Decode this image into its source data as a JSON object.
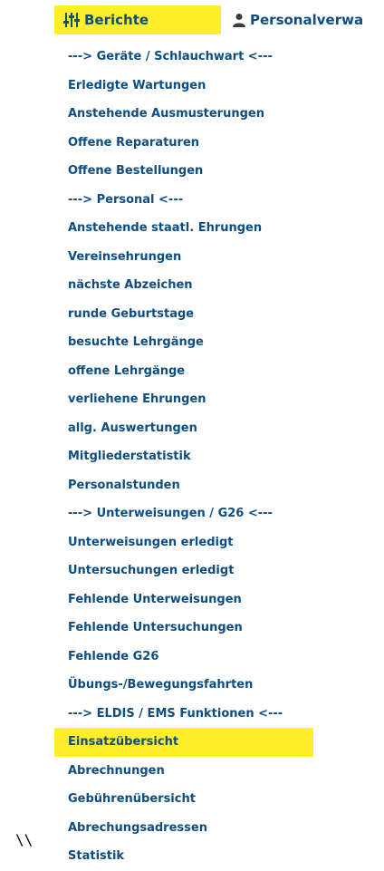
{
  "colors": {
    "highlight": "#ffef2a",
    "link": "#0d4d82"
  },
  "topnav": {
    "berichte": {
      "label": "Berichte",
      "icon": "sliders-icon",
      "active": true
    },
    "personal": {
      "label": "Personalverwa",
      "icon": "user-icon"
    }
  },
  "menu": {
    "items": [
      {
        "label": "---> Geräte / Schlauchwart <---",
        "type": "separator"
      },
      {
        "label": "Erledigte Wartungen"
      },
      {
        "label": "Anstehende Ausmusterungen"
      },
      {
        "label": "Offene Reparaturen"
      },
      {
        "label": "Offene Bestellungen"
      },
      {
        "label": "---> Personal <---",
        "type": "separator"
      },
      {
        "label": "Anstehende staatl. Ehrungen"
      },
      {
        "label": "Vereinsehrungen"
      },
      {
        "label": "nächste Abzeichen"
      },
      {
        "label": "runde Geburtstage"
      },
      {
        "label": "besuchte Lehrgänge"
      },
      {
        "label": "offene Lehrgänge"
      },
      {
        "label": "verliehene Ehrungen"
      },
      {
        "label": "allg. Auswertungen"
      },
      {
        "label": "Mitgliederstatistik"
      },
      {
        "label": "Personalstunden"
      },
      {
        "label": "---> Unterweisungen / G26 <---",
        "type": "separator"
      },
      {
        "label": "Unterweisungen erledigt"
      },
      {
        "label": "Untersuchungen erledigt"
      },
      {
        "label": "Fehlende Unterweisungen"
      },
      {
        "label": "Fehlende Untersuchungen"
      },
      {
        "label": "Fehlende G26"
      },
      {
        "label": "Übungs-/Bewegungsfahrten"
      },
      {
        "label": "---> ELDIS / EMS Funktionen <---",
        "type": "separator"
      },
      {
        "label": "Einsatzübersicht",
        "highlighted": true
      },
      {
        "label": "Abrechnungen"
      },
      {
        "label": "Gebührenübersicht"
      },
      {
        "label": "Abrechungsadressen"
      },
      {
        "label": "Statistik"
      }
    ]
  },
  "stray_text": "\\\\"
}
